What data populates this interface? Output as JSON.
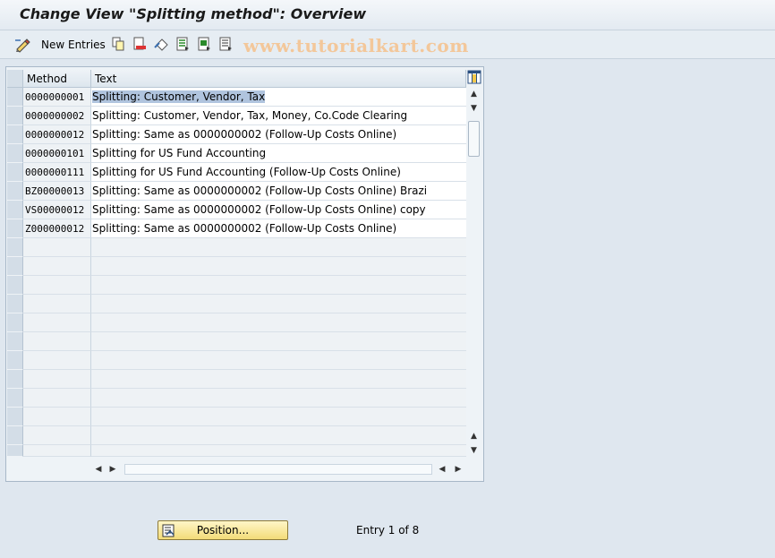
{
  "window": {
    "title": "Change View \"Splitting method\": Overview"
  },
  "toolbar": {
    "new_entries_label": "New Entries",
    "icons": [
      "display-change-icon",
      "copy-icon",
      "delete-icon",
      "undo-icon",
      "select-all-icon",
      "select-block-icon",
      "deselect-all-icon"
    ],
    "watermark": "www.tutorialkart.com"
  },
  "table": {
    "columns": [
      "Method",
      "Text"
    ],
    "rows": [
      {
        "method": "0000000001",
        "text": "Splitting: Customer, Vendor, Tax"
      },
      {
        "method": "0000000002",
        "text": "Splitting: Customer, Vendor, Tax, Money, Co.Code Clearing"
      },
      {
        "method": "0000000012",
        "text": "Splitting: Same as 0000000002 (Follow-Up Costs Online)"
      },
      {
        "method": "0000000101",
        "text": " Splitting for US Fund Accounting"
      },
      {
        "method": "0000000111",
        "text": "Splitting for US Fund Accounting (Follow-Up Costs Online)"
      },
      {
        "method": "BZ00000013",
        "text": "Splitting: Same as 0000000002 (Follow-Up Costs Online) Brazi"
      },
      {
        "method": "VS00000012",
        "text": "Splitting: Same as 0000000002 (Follow-Up Costs Online) copy"
      },
      {
        "method": "Z000000012",
        "text": "Splitting: Same as 0000000002 (Follow-Up Costs Online)"
      }
    ]
  },
  "footer": {
    "position_button": "Position...",
    "entry_text": "Entry 1 of 8"
  },
  "colors": {
    "accent_button": "#f3dc78",
    "highlight": "#b0c4de",
    "watermark": "#f3c79a"
  }
}
